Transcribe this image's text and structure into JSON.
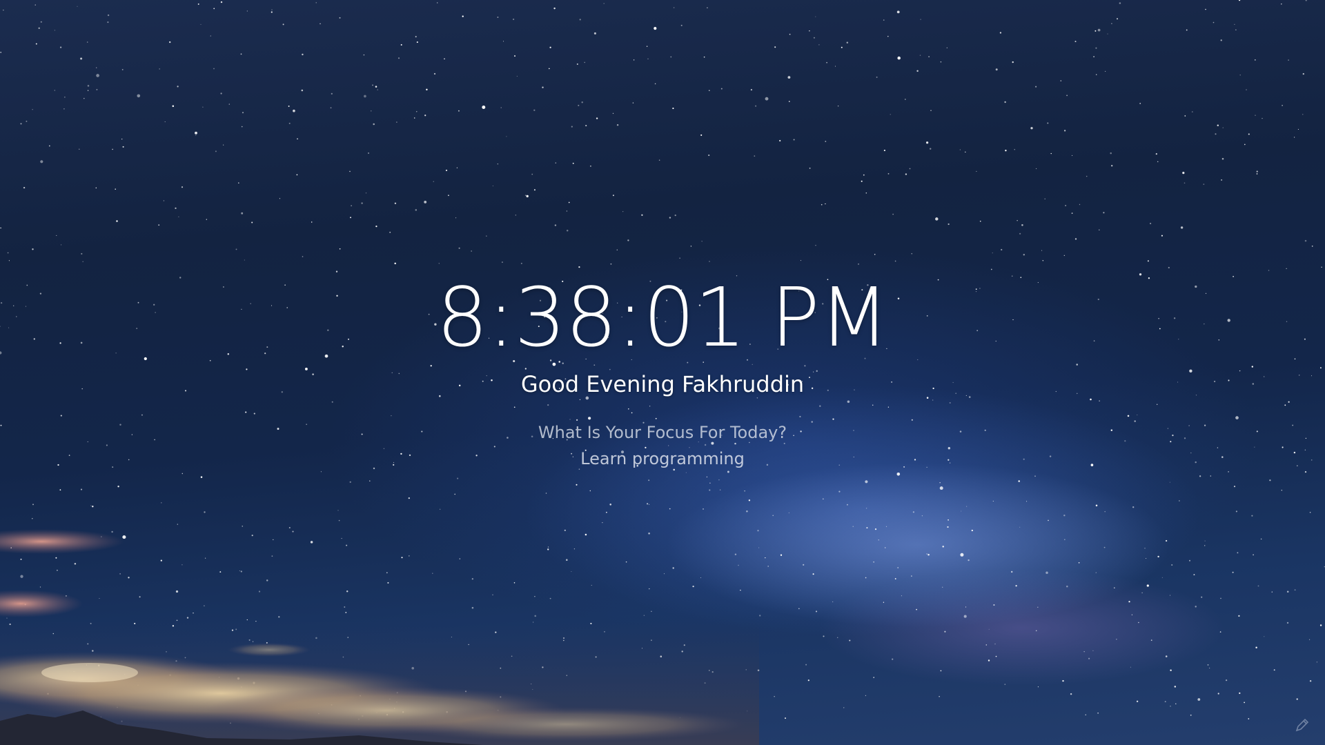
{
  "clock": {
    "time": "8:38:01 PM"
  },
  "greeting": {
    "text": "Good Evening Fakhruddin"
  },
  "focus": {
    "question": "What Is Your Focus For Today?",
    "value": "Learn programming"
  },
  "icons": {
    "corner": "edit-icon"
  },
  "colors": {
    "text": "#ffffff",
    "muted_text": "#dce1eb",
    "sky_dark": "#132341",
    "sky_glow": "#4a6ec8"
  }
}
